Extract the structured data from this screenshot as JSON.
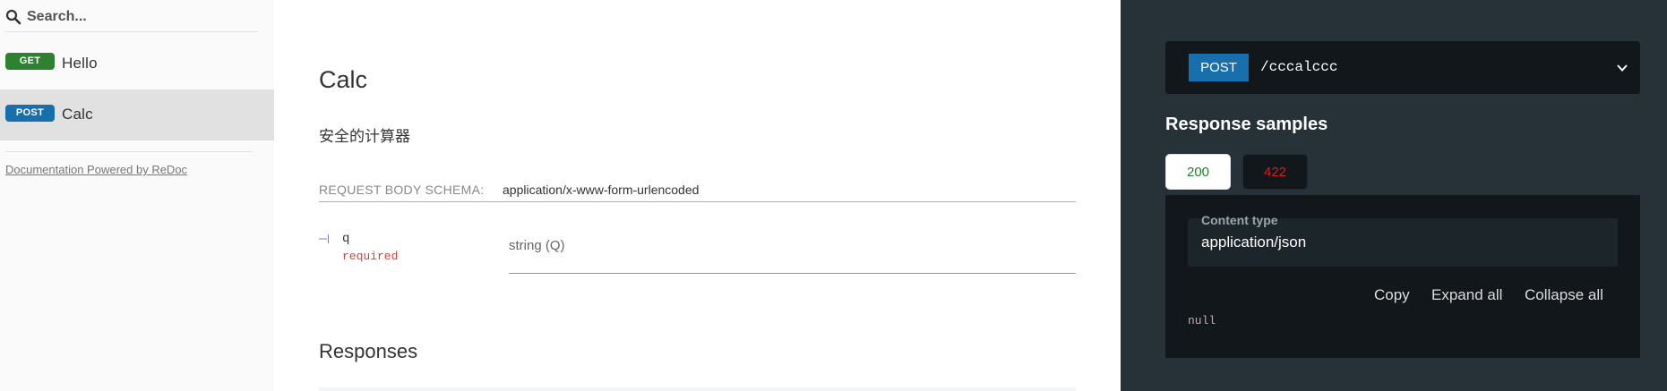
{
  "sidebar": {
    "search": {
      "placeholder": "Search..."
    },
    "items": [
      {
        "method": "GET",
        "label": "Hello",
        "active": false
      },
      {
        "method": "POST",
        "label": "Calc",
        "active": true
      }
    ],
    "powered_by": "Documentation Powered by ReDoc"
  },
  "operation": {
    "title": "Calc",
    "description": "安全的计算器",
    "request_body": {
      "label": "REQUEST BODY SCHEMA:",
      "content_type": "application/x-www-form-urlencoded"
    },
    "params": [
      {
        "name": "q",
        "required_label": "required",
        "type": "string (Q)"
      }
    ],
    "responses_title": "Responses"
  },
  "right_panel": {
    "endpoint": {
      "method": "POST",
      "path": "/cccalccc"
    },
    "samples_title": "Response samples",
    "tabs": [
      {
        "code": "200",
        "active": true,
        "color": "#1d8127"
      },
      {
        "code": "422",
        "active": false,
        "color": "#d41f1c"
      }
    ],
    "content_type": {
      "label": "Content type",
      "value": "application/json"
    },
    "tools": {
      "copy": "Copy",
      "expand_all": "Expand all",
      "collapse_all": "Collapse all"
    },
    "sample_body": "null"
  },
  "colors": {
    "get": "#2f8132",
    "post": "#186fad",
    "right_panel_bg": "#263238",
    "code_bg": "#11171a"
  },
  "icons": {
    "search": "search-icon",
    "chevron": "chevron-down-icon",
    "tree": "tree-branch-icon"
  }
}
